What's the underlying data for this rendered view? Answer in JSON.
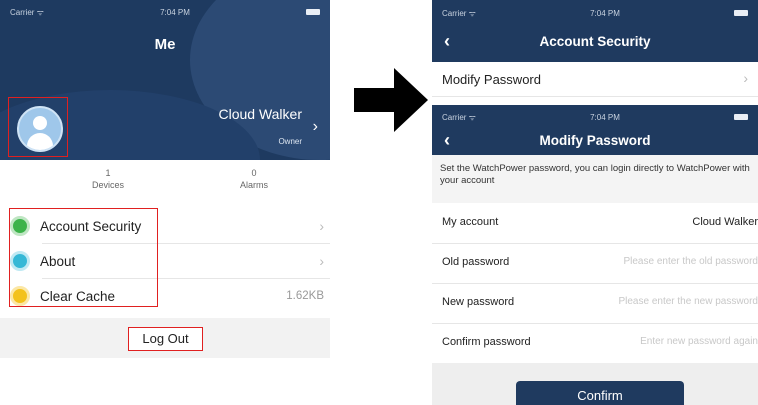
{
  "left_screen": {
    "status": {
      "carrier": "Carrier ᯤ",
      "time": "7:04 PM"
    },
    "title": "Me",
    "user": {
      "name": "Cloud Walker",
      "role": "Owner"
    },
    "stats": [
      {
        "value": "1",
        "label": "Devices"
      },
      {
        "value": "0",
        "label": "Alarms"
      }
    ],
    "menu": [
      {
        "label": "Account Security",
        "right": "›",
        "icon": "shield-icon",
        "color": "#3cb34a"
      },
      {
        "label": "About",
        "right": "›",
        "icon": "info-icon",
        "color": "#35b8d6"
      },
      {
        "label": "Clear Cache",
        "right": "1.62KB",
        "icon": "broom-icon",
        "color": "#f3c21c"
      }
    ],
    "logout_label": "Log Out"
  },
  "account_security": {
    "status": {
      "carrier": "Carrier ᯤ",
      "time": "7:04 PM"
    },
    "back": "‹",
    "title": "Account Security",
    "row_label": "Modify Password",
    "row_chevron": "›"
  },
  "modify_password": {
    "status": {
      "carrier": "Carrier ᯤ",
      "time": "7:04 PM"
    },
    "back": "‹",
    "title": "Modify Password",
    "notice": "Set the WatchPower password, you can login directly to WatchPower with your account",
    "fields": [
      {
        "label": "My account",
        "value": "Cloud Walker"
      },
      {
        "label": "Old password",
        "placeholder": "Please enter the old password"
      },
      {
        "label": "New password",
        "placeholder": "Please enter the new password"
      },
      {
        "label": "Confirm password",
        "placeholder": "Enter new password again"
      }
    ],
    "confirm_label": "Confirm"
  },
  "colors": {
    "header_navy": "#1f3a5f",
    "highlight_red": "#e02020",
    "arrow": "#000000"
  }
}
